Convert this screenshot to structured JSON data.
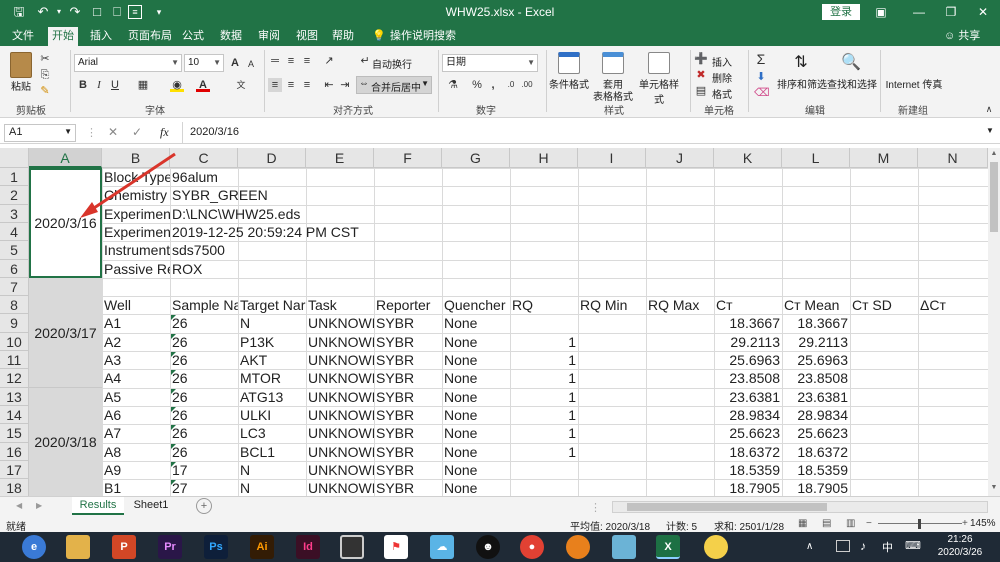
{
  "window": {
    "title": "WHW25.xlsx  -  Excel",
    "login": "登录",
    "share": "共享",
    "colors": {
      "brand": "#217346",
      "arrow": "#d9352b",
      "selected_cell_fill": "#d9d9d9"
    }
  },
  "tabs": [
    "文件",
    "开始",
    "插入",
    "页面布局",
    "公式",
    "数据",
    "审阅",
    "视图",
    "帮助",
    "操作说明搜索"
  ],
  "active_tab": "开始",
  "ribbon": {
    "clipboard": {
      "paste": "粘贴",
      "label": "剪贴板"
    },
    "font": {
      "name": "Arial",
      "size": "10",
      "label": "字体",
      "bold": "B",
      "italic": "I",
      "underline": "U",
      "grow": "A",
      "shrink": "A"
    },
    "alignment": {
      "wrap": "自动换行",
      "merge": "合并后居中",
      "label": "对齐方式"
    },
    "number": {
      "format": "日期",
      "label": "数字",
      "percent": "%",
      "comma": ","
    },
    "styles": {
      "conditional": "条件格式",
      "table": "套用",
      "table2": "表格格式",
      "cell": "单元格样式",
      "label": "样式"
    },
    "cells": {
      "insert": "插入",
      "delete": "删除",
      "format": "格式",
      "label": "单元格"
    },
    "editing": {
      "sort": "排序和筛选",
      "find": "查找和选择",
      "label": "编辑"
    },
    "newgroup": {
      "browser": "Internet 传真",
      "label": "新建组"
    }
  },
  "formula_bar": {
    "name_box": "A1",
    "fx": "fx",
    "value": "2020/3/16"
  },
  "columns": [
    "A",
    "B",
    "C",
    "D",
    "E",
    "F",
    "G",
    "H",
    "I",
    "J",
    "K",
    "L",
    "M",
    "N"
  ],
  "rows": [
    "1",
    "2",
    "3",
    "4",
    "5",
    "6",
    "7",
    "8",
    "9",
    "10",
    "11",
    "12",
    "13",
    "14",
    "15",
    "16",
    "17",
    "18"
  ],
  "merged": [
    "2020/3/16",
    "2020/3/17",
    "2020/3/18"
  ],
  "meta": [
    [
      "Block Type",
      "96alum"
    ],
    [
      "Chemistry",
      "SYBR_GREEN"
    ],
    [
      "Experiment",
      "D:\\LNC\\WHW25.eds"
    ],
    [
      "Experiment",
      "2019-12-25 20:59:24 PM CST"
    ],
    [
      "Instrument",
      "sds7500"
    ],
    [
      "Passive Re",
      "ROX"
    ]
  ],
  "headers": [
    "Well",
    "Sample Na",
    "Target Nar",
    "Task",
    "Reporter",
    "Quencher",
    "RQ",
    "RQ Min",
    "RQ Max",
    "Cт",
    "Cт Mean",
    "Cт SD",
    "ΔCт"
  ],
  "data_rows": [
    [
      "A1",
      "26",
      "N",
      "UNKNOWN",
      "SYBR",
      "None",
      "",
      "18.3667",
      "18.3667"
    ],
    [
      "A2",
      "26",
      "P13K",
      "UNKNOWN",
      "SYBR",
      "None",
      "1",
      "29.2113",
      "29.2113"
    ],
    [
      "A3",
      "26",
      "AKT",
      "UNKNOWN",
      "SYBR",
      "None",
      "1",
      "25.6963",
      "25.6963"
    ],
    [
      "A4",
      "26",
      "MTOR",
      "UNKNOWN",
      "SYBR",
      "None",
      "1",
      "23.8508",
      "23.8508"
    ],
    [
      "A5",
      "26",
      "ATG13",
      "UNKNOWN",
      "SYBR",
      "None",
      "1",
      "23.6381",
      "23.6381"
    ],
    [
      "A6",
      "26",
      "ULKI",
      "UNKNOWN",
      "SYBR",
      "None",
      "1",
      "28.9834",
      "28.9834"
    ],
    [
      "A7",
      "26",
      "LC3",
      "UNKNOWN",
      "SYBR",
      "None",
      "1",
      "25.6623",
      "25.6623"
    ],
    [
      "A8",
      "26",
      "BCL1",
      "UNKNOWN",
      "SYBR",
      "None",
      "1",
      "18.6372",
      "18.6372"
    ],
    [
      "A9",
      "17",
      "N",
      "UNKNOWN",
      "SYBR",
      "None",
      "",
      "18.5359",
      "18.5359"
    ],
    [
      "B1",
      "27",
      "N",
      "UNKNOWN",
      "SYBR",
      "None",
      "",
      "18.7905",
      "18.7905"
    ]
  ],
  "sheets": [
    "Results",
    "Sheet1"
  ],
  "active_sheet": "Results",
  "status": {
    "ready": "就绪",
    "average": "平均值: 2020/3/18",
    "count": "计数: 5",
    "sum": "求和: 2501/1/28",
    "zoom": "145%"
  },
  "taskbar": {
    "time": "21:26",
    "date": "2020/3/26",
    "apps": [
      "P",
      "Pr",
      "Ps",
      "Ai",
      "Id"
    ]
  }
}
